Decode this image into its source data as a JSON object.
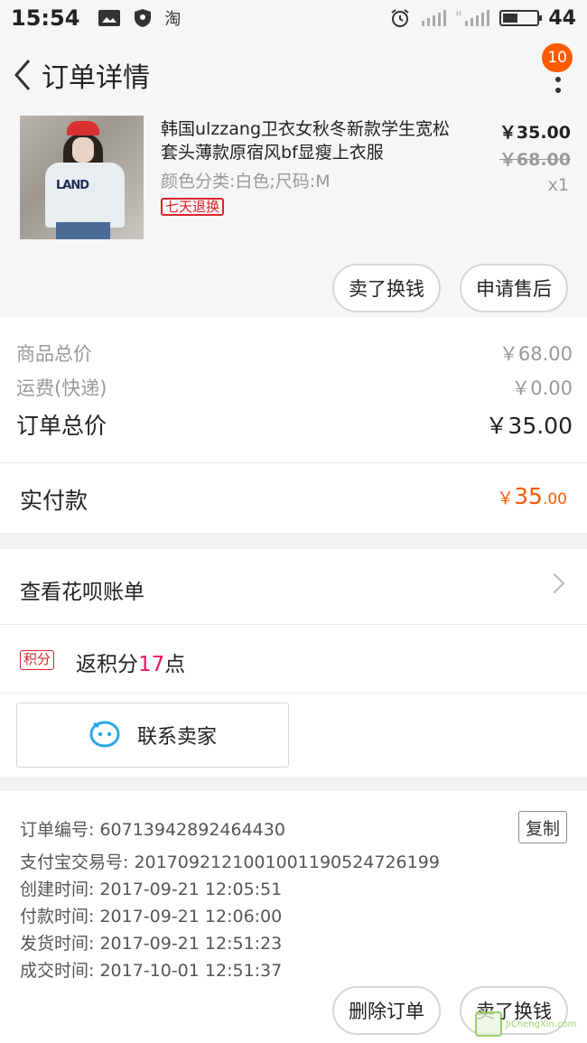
{
  "status_bar": {
    "time": "15:54",
    "taobao_glyph": "淘",
    "battery_level": "44",
    "battery_fill": 0.44,
    "icons": [
      "picture-icon",
      "shield-icon",
      "taobao-icon",
      "alarm-icon",
      "signal-icon",
      "signal-icon",
      "battery-icon"
    ]
  },
  "header": {
    "title": "订单详情",
    "badge": "10"
  },
  "product": {
    "name": "韩国ulzzang卫衣女秋冬新款学生宽松套头薄款原宿风bf显瘦上衣服",
    "spec": "颜色分类:白色;尺码:M",
    "tag": "七天退换",
    "price": "￥35.00",
    "original_price": "￥68.00",
    "quantity": "x1",
    "thumb_text": "LAND",
    "actions": {
      "sell": "卖了换钱",
      "after_sale": "申请售后"
    }
  },
  "summary": {
    "goods_label": "商品总价",
    "goods_value": "￥68.00",
    "shipping_label": "运费(快递)",
    "shipping_value": "￥0.00",
    "total_label": "订单总价",
    "total_value": "￥35.00",
    "paid_label": "实付款",
    "paid_currency": "￥",
    "paid_int": "35",
    "paid_dec": ".00"
  },
  "huabei": {
    "label": "查看花呗账单"
  },
  "points": {
    "tag": "积分",
    "prefix": "返积分",
    "num": "17",
    "suffix": "点"
  },
  "contact": {
    "label": "联系卖家"
  },
  "order_info": {
    "copy": "复制",
    "lines": [
      "订单编号: 60713942892464430",
      "支付宝交易号: 2017092121001001190524726199",
      "创建时间: 2017-09-21 12:05:51",
      "付款时间: 2017-09-21 12:06:00",
      "发货时间: 2017-09-21 12:51:23",
      "成交时间: 2017-10-01 12:51:37"
    ],
    "actions": {
      "delete": "删除订单",
      "sell": "卖了换钱"
    }
  },
  "watermark": "JiChengXin.com",
  "colors": {
    "accent": "#ff5a00",
    "tag_red": "#d9262d",
    "points_pink": "#e61a5a"
  }
}
